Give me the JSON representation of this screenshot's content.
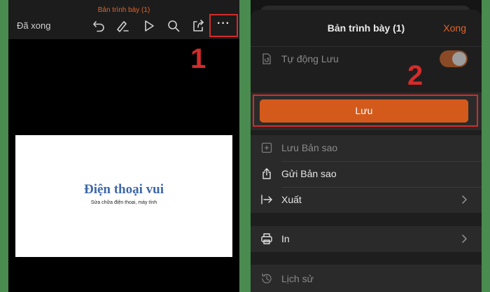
{
  "left": {
    "doc_title": "Bản trình bày (1)",
    "done_label": "Đã xong",
    "toolbar_icons": [
      "undo-icon",
      "draw-icon",
      "play-icon",
      "search-icon",
      "share-icon"
    ],
    "more_label": "···",
    "step_number": "1",
    "slide": {
      "title": "Điện thoại vui",
      "subtitle": "Sửa chữa điện thoại, máy tính"
    }
  },
  "right": {
    "sheet_title": "Bản trình bày (1)",
    "done_label": "Xong",
    "step_number": "2",
    "autosave": {
      "label": "Tự động Lưu",
      "enabled": true
    },
    "save_label": "Lưu",
    "menu_group1": [
      {
        "label": "Lưu Bản sao",
        "icon": "plus-square-icon",
        "dim": true
      },
      {
        "label": "Gửi Bản sao",
        "icon": "share-icon",
        "dim": false
      },
      {
        "label": "Xuất",
        "icon": "export-icon",
        "dim": false,
        "chevron": true
      }
    ],
    "print_label": "In",
    "history_label": "Lịch sử"
  },
  "colors": {
    "accent": "#e2652a",
    "save_button": "#d45a1c",
    "highlight_frame": "#d42b2b",
    "background": "#4a8b4f",
    "slide_title": "#3e68a8"
  }
}
